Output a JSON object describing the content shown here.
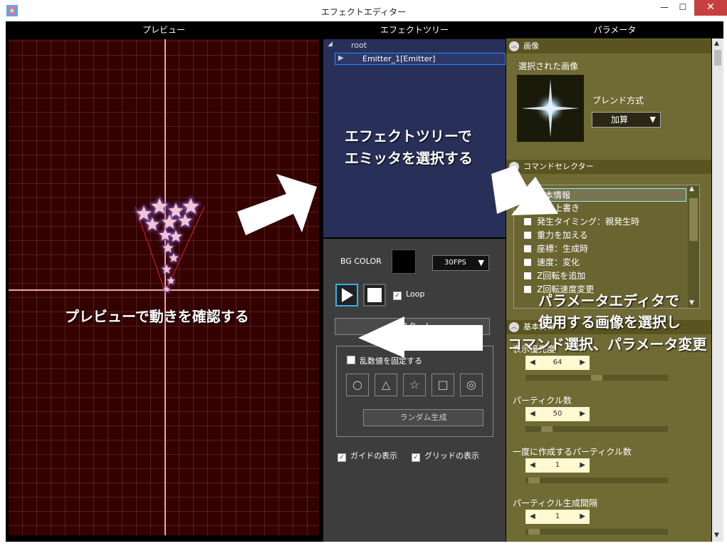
{
  "window": {
    "title": "エフェクトエディター",
    "minimize": "—",
    "maximize": "☐",
    "close": "✕"
  },
  "headers": {
    "preview": "プレビュー",
    "tree": "エフェクトツリー",
    "params": "パラメータ"
  },
  "tree": {
    "root_label": "root",
    "selected_item": "Emitter_1[Emitter]"
  },
  "bg_panel": {
    "bg_color_label": "BG COLOR",
    "bg_color": "#000000",
    "fps_value": "30FPS",
    "loop_label": "Loop",
    "loop_checked": true,
    "restart_label": "リスタート",
    "fix_random_label": "乱数値を固定する",
    "fix_random_checked": false,
    "shapes": [
      "○",
      "△",
      "☆",
      "□",
      "◎"
    ],
    "random_gen_label": "ランダム生成",
    "guide_label": "ガイドの表示",
    "guide_checked": true,
    "grid_label": "グリッドの表示",
    "grid_checked": true
  },
  "params": {
    "image_section": "画像",
    "selected_image_label": "選択された画像",
    "blend_label": "ブレンド方式",
    "blend_value": "加算",
    "command_section": "コマンドセレクター",
    "commands": [
      {
        "label": "基本情報",
        "checked": true,
        "selected": true
      },
      {
        "label": "色：上書き",
        "checked": false
      },
      {
        "label": "発生タイミング：親発生時",
        "checked": false
      },
      {
        "label": "重力を加える",
        "checked": false
      },
      {
        "label": "座標：生成時",
        "checked": false
      },
      {
        "label": "速度：変化",
        "checked": false
      },
      {
        "label": "Z回転を追加",
        "checked": false
      },
      {
        "label": "Z回転速度変更",
        "checked": false
      }
    ],
    "basic_section": "基本情報",
    "fields": [
      {
        "label": "表示優先度",
        "value": "64",
        "level": 0.5
      },
      {
        "label": "パーティクル数",
        "value": "50",
        "level": 0.12
      },
      {
        "label": "一度に作成するパーティクル数",
        "value": "1",
        "level": 0.02
      },
      {
        "label": "パーティクル生成間隔",
        "value": "1",
        "level": 0.02
      }
    ]
  },
  "annotations": {
    "preview_note": "プレビューで動きを確認する",
    "tree_note_1": "エフェクトツリーで",
    "tree_note_2": "エミッタを選択する",
    "param_note_1": "パラメータエディタで",
    "param_note_2": "使用する画像を選択し",
    "param_note_3": "コマンド選択、パラメータ変更"
  },
  "colors": {
    "preview_bg": "#350000",
    "tree_bg": "#28305a",
    "param_bg": "#706a34",
    "particle": "#f7b8cc",
    "selection": "#1e90ff"
  }
}
